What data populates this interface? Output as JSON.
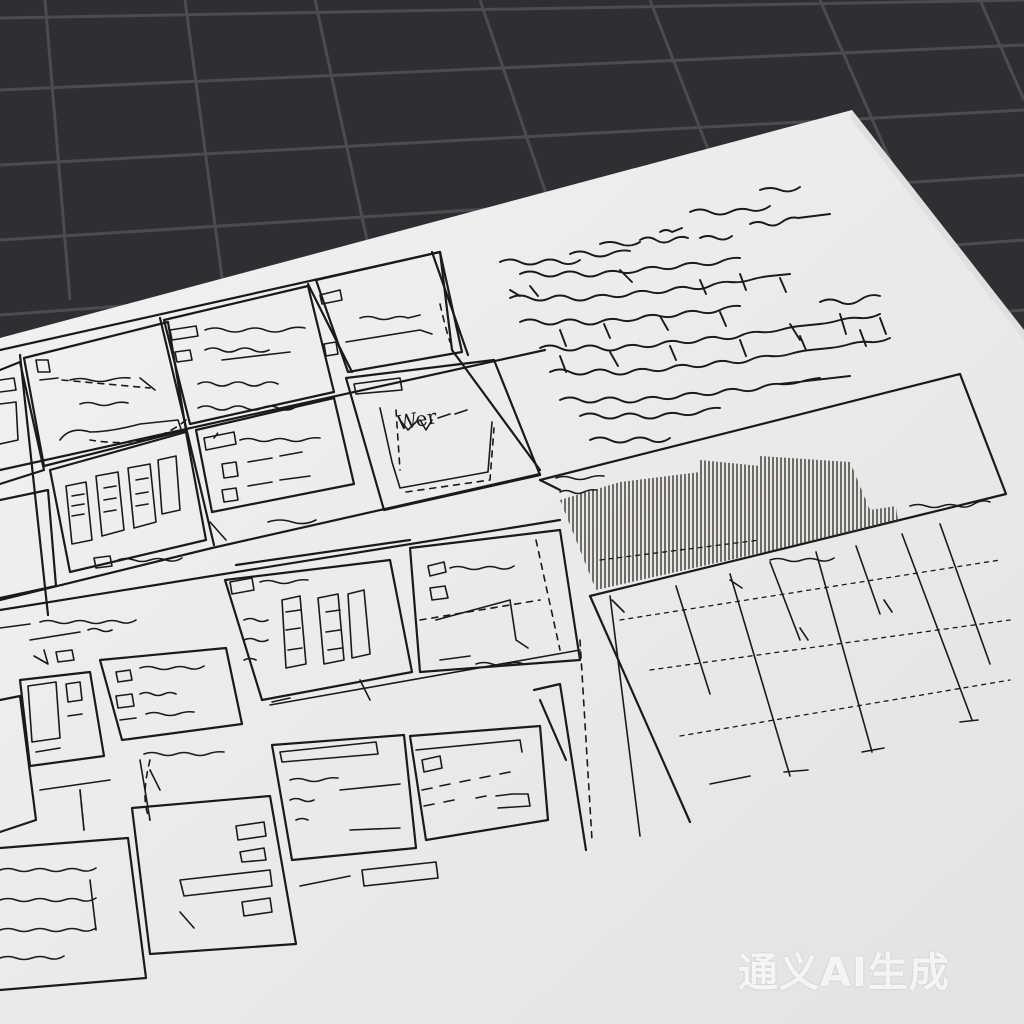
{
  "watermark": {
    "text": "通义AI生成"
  },
  "colors": {
    "background": "#2e2f33",
    "grid": "#4a4b50",
    "paper": "#eceded",
    "ink": "#1a1a1a"
  },
  "sketch": {
    "label_wer": "Wer"
  }
}
